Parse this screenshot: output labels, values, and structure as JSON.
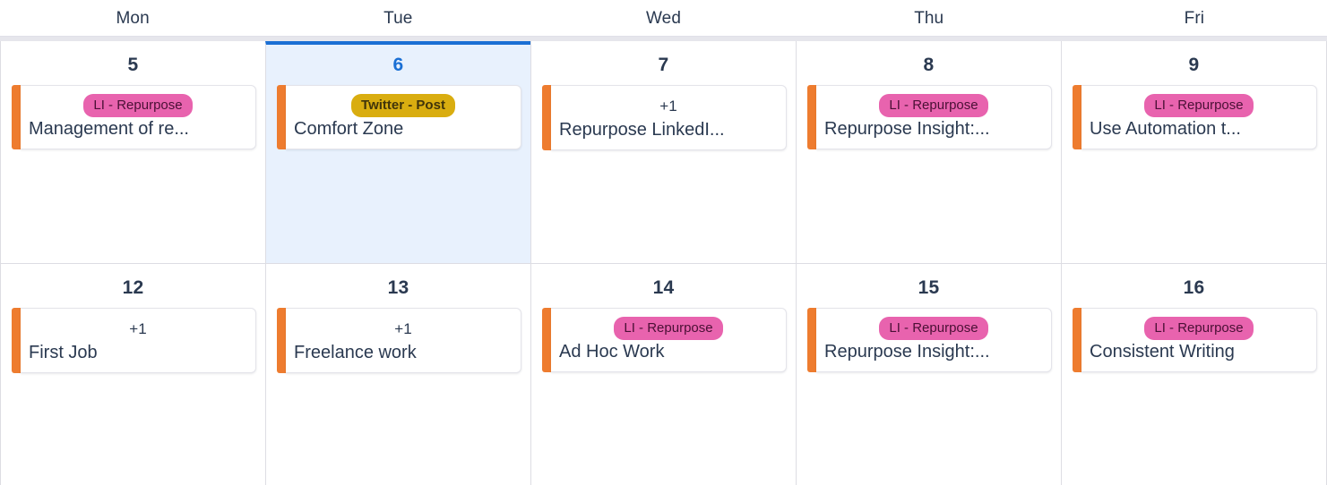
{
  "calendar": {
    "weekday_headers": [
      "Mon",
      "Tue",
      "Wed",
      "Thu",
      "Fri"
    ],
    "colors": {
      "today_highlight": "#e8f1fd",
      "today_border": "#1a6fd4",
      "today_number": "#1a6fd4",
      "event_accent_bar": "#ee7c2f",
      "tag_pink": "#e863ae",
      "tag_gold": "#d9ad10",
      "text": "#2a3950",
      "grid_line": "#dddde3"
    },
    "weeks": [
      {
        "days": [
          {
            "date": "5",
            "weekday": "Mon",
            "is_today": false,
            "events": [
              {
                "tag": "LI - Repurpose",
                "tag_style": "pink",
                "title": "Management of re..."
              }
            ]
          },
          {
            "date": "6",
            "weekday": "Tue",
            "is_today": true,
            "events": [
              {
                "tag": "Twitter - Post",
                "tag_style": "gold",
                "title": "Comfort Zone"
              }
            ]
          },
          {
            "date": "7",
            "weekday": "Wed",
            "is_today": false,
            "events": [
              {
                "tag": "+1",
                "tag_style": "plain",
                "title": "Repurpose LinkedI..."
              }
            ]
          },
          {
            "date": "8",
            "weekday": "Thu",
            "is_today": false,
            "events": [
              {
                "tag": "LI - Repurpose",
                "tag_style": "pink",
                "title": "Repurpose Insight:..."
              }
            ]
          },
          {
            "date": "9",
            "weekday": "Fri",
            "is_today": false,
            "events": [
              {
                "tag": "LI - Repurpose",
                "tag_style": "pink",
                "title": "Use Automation t..."
              }
            ]
          }
        ]
      },
      {
        "days": [
          {
            "date": "12",
            "weekday": "Mon",
            "is_today": false,
            "events": [
              {
                "tag": "+1",
                "tag_style": "plain",
                "title": "First Job"
              }
            ]
          },
          {
            "date": "13",
            "weekday": "Tue",
            "is_today": false,
            "events": [
              {
                "tag": "+1",
                "tag_style": "plain",
                "title": "Freelance work"
              }
            ]
          },
          {
            "date": "14",
            "weekday": "Wed",
            "is_today": false,
            "events": [
              {
                "tag": "LI - Repurpose",
                "tag_style": "pink",
                "title": "Ad Hoc Work"
              }
            ]
          },
          {
            "date": "15",
            "weekday": "Thu",
            "is_today": false,
            "events": [
              {
                "tag": "LI - Repurpose",
                "tag_style": "pink",
                "title": "Repurpose Insight:..."
              }
            ]
          },
          {
            "date": "16",
            "weekday": "Fri",
            "is_today": false,
            "events": [
              {
                "tag": "LI - Repurpose",
                "tag_style": "pink",
                "title": "Consistent Writing"
              }
            ]
          }
        ]
      }
    ]
  }
}
